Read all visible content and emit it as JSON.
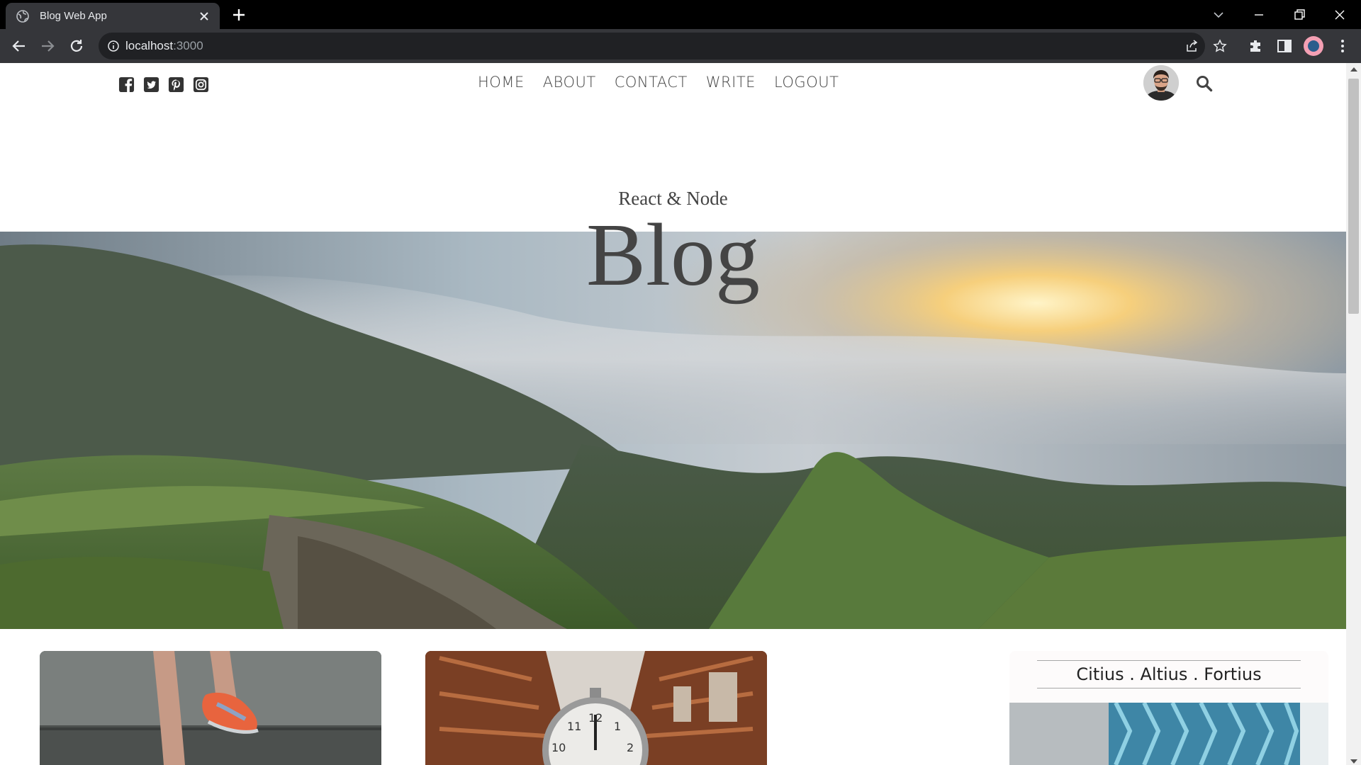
{
  "browser": {
    "tab_title": "Blog Web App",
    "url_host": "localhost",
    "url_port": ":3000"
  },
  "nav": {
    "socials": [
      "facebook-square-icon",
      "twitter-square-icon",
      "pinterest-square-icon",
      "instagram-icon"
    ],
    "links": [
      "HOME",
      "ABOUT",
      "CONTACT",
      "WRITE",
      "LOGOUT"
    ]
  },
  "header": {
    "subtitle": "React & Node",
    "title": "Blog"
  },
  "sidebar": {
    "title": "Citius . Altius . Fortius"
  }
}
